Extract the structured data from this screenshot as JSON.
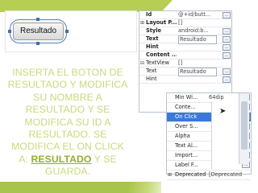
{
  "canvas": {
    "button_label": "Resultado"
  },
  "instruction": {
    "lines": [
      "INSERTA EL BOTON DE",
      "RESULTADO Y MODIFICA",
      "SU NOMBRE A",
      "RESULTADO Y SE",
      "MODIFICA SU ID A",
      "RESULTADO. SE",
      "MODIFICA EL ON CLICK"
    ],
    "last_prefix": "A: ",
    "last_keyword": "RESULTADO",
    "last_suffix": " Y SE",
    "final_line": "GUARDA."
  },
  "properties_top": {
    "rows": [
      {
        "expander": "",
        "name": "Id",
        "value": "@+id/butt...",
        "bold": true,
        "button": "…"
      },
      {
        "expander": "⊞",
        "name": "Layout P...",
        "value": "[]",
        "bold": true,
        "button": ""
      },
      {
        "expander": "",
        "name": "Style",
        "value": "android:b...",
        "bold": true,
        "button": "…"
      },
      {
        "expander": "",
        "name": "Text",
        "value": "Resultado",
        "bold": true,
        "button": "…"
      },
      {
        "expander": "",
        "name": "Hint",
        "value": "",
        "bold": true,
        "button": "…"
      },
      {
        "expander": "",
        "name": "Content ...",
        "value": "",
        "bold": true,
        "button": "…"
      },
      {
        "expander": "⊟",
        "name": "TextView",
        "value": "[]",
        "bold": false,
        "button": ""
      },
      {
        "expander": "",
        "name": "Text",
        "value": "Resultado",
        "bold": false,
        "button": "…"
      },
      {
        "expander": "",
        "name": "Hint",
        "value": "",
        "bold": false,
        "button": "…"
      }
    ]
  },
  "properties_bottom": {
    "rows": [
      {
        "name": "Min Wi...",
        "value": "64dip",
        "button": "…"
      },
      {
        "name": "Conte...",
        "value": "",
        "button": "…"
      },
      {
        "name": "On Click",
        "value": "",
        "button": "…",
        "selected": true
      },
      {
        "name": "Over S...",
        "value": "",
        "button": "…"
      },
      {
        "name": "Alpha",
        "value": "",
        "button": "…"
      },
      {
        "name": "Text Al...",
        "value": "",
        "button": "…"
      },
      {
        "name": "Import...",
        "value": "",
        "button": "…"
      },
      {
        "name": "Label F...",
        "value": "",
        "button": "…"
      },
      {
        "name": "Deprecated",
        "value": "[Deprecated ...",
        "button": "",
        "expander": "⊞"
      }
    ]
  }
}
